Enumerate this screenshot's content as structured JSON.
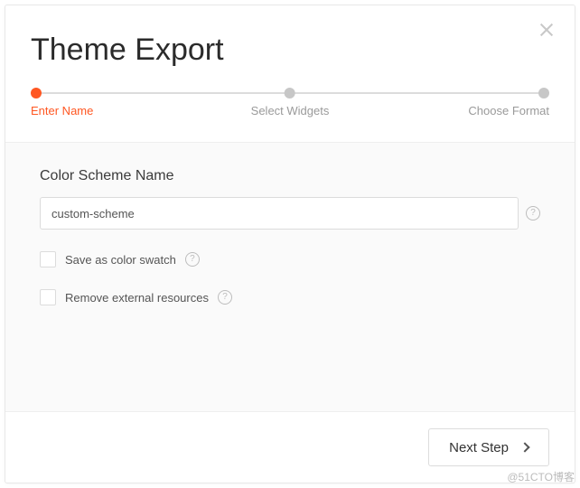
{
  "title": "Theme Export",
  "stepper": {
    "active_index": 0,
    "steps": [
      "Enter Name",
      "Select Widgets",
      "Choose Format"
    ]
  },
  "form": {
    "field_label": "Color Scheme Name",
    "scheme_name_value": "custom-scheme",
    "save_swatch_label": "Save as color swatch",
    "save_swatch_checked": false,
    "remove_resources_label": "Remove external resources",
    "remove_resources_checked": false
  },
  "footer": {
    "next_label": "Next Step"
  },
  "watermark": "@51CTO博客",
  "colors": {
    "accent": "#ff5722"
  }
}
